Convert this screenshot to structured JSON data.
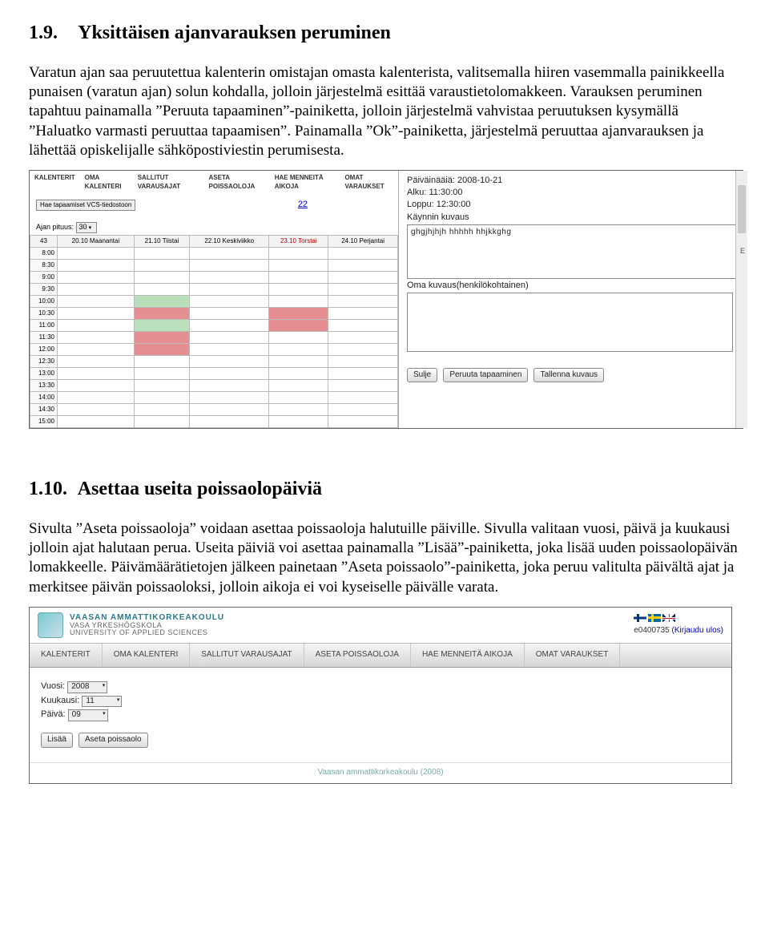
{
  "section1": {
    "number": "1.9.",
    "title": "Yksittäisen ajanvarauksen peruminen",
    "paragraph": "Varatun ajan saa peruutettua kalenterin omistajan omasta kalenterista, valitsemalla hiiren vasemmalla painikkeella punaisen (varatun ajan) solun kohdalla, jolloin järjestelmä esittää varaustietolomakkeen. Varauksen peruminen tapahtuu painamalla ”Peruuta tapaaminen”-painiketta, jolloin järjestelmä vahvistaa peruutuksen kysymällä ”Haluatko varmasti peruuttaa tapaamisen”. Painamalla ”Ok”-painiketta, järjestelmä peruuttaa ajanvarauksen ja lähettää opiskelijalle sähköpostiviestin perumisesta."
  },
  "calendar": {
    "tabs": [
      "KALENTERIT",
      "OMA KALENTERI",
      "SALLITUT VARAUSAJAT",
      "ASETA POISSAOLOJA",
      "HAE MENNEITÄ AIKOJA",
      "OMAT VARAUKSET"
    ],
    "vcs_button": "Hae tapaamiset VCS-tiedostoon",
    "link": "22",
    "duration_label": "Ajan pituus:",
    "duration_value": "30",
    "week": "43",
    "days": [
      {
        "label": "20.10 Maanantai",
        "today": false
      },
      {
        "label": "21.10 Tiistai",
        "today": false
      },
      {
        "label": "22.10 Keskiviikko",
        "today": false
      },
      {
        "label": "23.10 Torstai",
        "today": true
      },
      {
        "label": "24.10 Perjantai",
        "today": false
      }
    ],
    "times": [
      "8:00",
      "8:30",
      "9:00",
      "9:30",
      "10:00",
      "10:30",
      "11:00",
      "11:30",
      "12:00",
      "12:30",
      "13:00",
      "13:30",
      "14:00",
      "14:30",
      "15:00"
    ]
  },
  "details": {
    "date_label": "Päiväinääiä: 2008-10-21",
    "start": "Alku: 11:30:00",
    "end": "Loppu: 12:30:00",
    "desc_label": "Käynnin kuvaus",
    "desc_text": "ghgjhjhjh   hhhhh   hhjkkghg",
    "own_label": "Oma kuvaus(henkilökohtainen)",
    "buttons": {
      "close": "Sulje",
      "cancel": "Peruuta tapaaminen",
      "save": "Tallenna kuvaus"
    }
  },
  "section2": {
    "number": "1.10.",
    "title": "Asettaa useita poissaolopäiviä",
    "paragraph": "Sivulta ”Aseta poissaoloja” voidaan asettaa poissaoloja halutuille päiville. Sivulla valitaan vuosi, päivä ja kuukausi jolloin ajat halutaan perua. Useita päiviä voi asettaa painamalla ”Lisää”-painiketta, joka lisää uuden poissaolopäivän lomakkeelle. Päivämäärätietojen jälkeen painetaan ”Aseta poissaolo”-painiketta, joka peruu valitulta päivältä ajat ja merkitsee päivän poissaoloksi, jolloin aikoja ei voi kyseiselle päivälle varata."
  },
  "app": {
    "logo": {
      "name": "VAASAN AMMATTIKORKEAKOULU",
      "sub1": "VASA YRKESHÖGSKOLA",
      "sub2": "UNIVERSITY OF APPLIED SCIENCES"
    },
    "user_id": "e0400735",
    "logout": "(Kirjaudu ulos)",
    "nav": [
      "KALENTERIT",
      "OMA KALENTERI",
      "SALLITUT VARAUSAJAT",
      "ASETA POISSAOLOJA",
      "HAE MENNEITÄ AIKOJA",
      "OMAT VARAUKSET"
    ],
    "fields": {
      "year_label": "Vuosi:",
      "year_value": "2008",
      "month_label": "Kuukausi:",
      "month_value": "11",
      "day_label": "Päivä:",
      "day_value": "09"
    },
    "buttons": {
      "add": "Lisää",
      "set": "Aseta poissaolo"
    },
    "footer": "Vaasan ammattikorkeakoulu (2008)"
  }
}
